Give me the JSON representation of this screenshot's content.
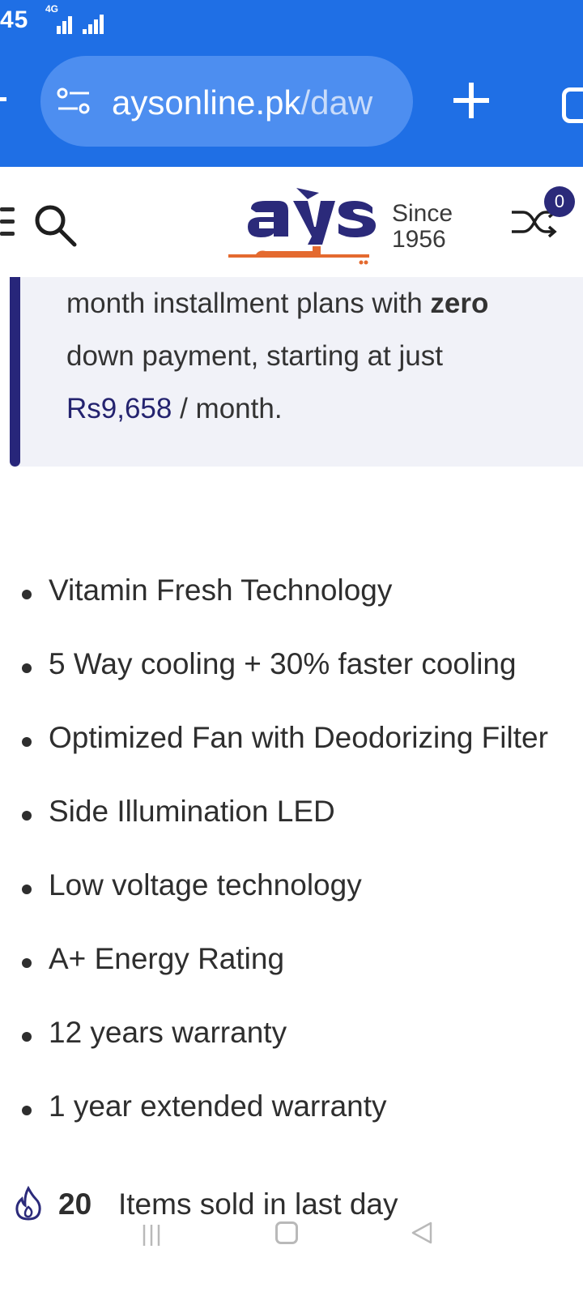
{
  "status_bar": {
    "time": "45",
    "network": "4G"
  },
  "browser": {
    "url_domain": "aysonline.pk",
    "url_path": "/daw",
    "icons": {
      "site_settings": "site-settings-icon",
      "new_tab": "plus-icon",
      "tabs": "tab-switcher-icon"
    },
    "colors": {
      "toolbar": "#1f6fe5",
      "pill": "#4d8ef0"
    }
  },
  "header": {
    "logo_since": "Since",
    "logo_year": "1956",
    "compare_count": "0",
    "icons": {
      "menu": "hamburger-menu-icon",
      "search": "search-icon",
      "compare": "shuffle-compare-icon"
    }
  },
  "installment": {
    "line1_prefix": "month installment plans with",
    "line1_strong": "zero",
    "line2": "down payment, starting at just",
    "price": "Rs9,658",
    "price_suffix": "/ month.",
    "accent_color": "#27267a"
  },
  "features": [
    "Vitamin Fresh Technology",
    "5 Way cooling + 30% faster cooling",
    "Optimized Fan with Deodorizing Filter",
    "Side Illumination LED",
    "Low voltage technology",
    "A+ Energy Rating",
    "12 years warranty",
    "1 year extended warranty"
  ],
  "sold": {
    "count": "20",
    "text": "Items sold in last day",
    "icon": "fire-icon"
  },
  "nav": {
    "icons": [
      "recents-icon",
      "home-icon",
      "back-icon"
    ]
  }
}
